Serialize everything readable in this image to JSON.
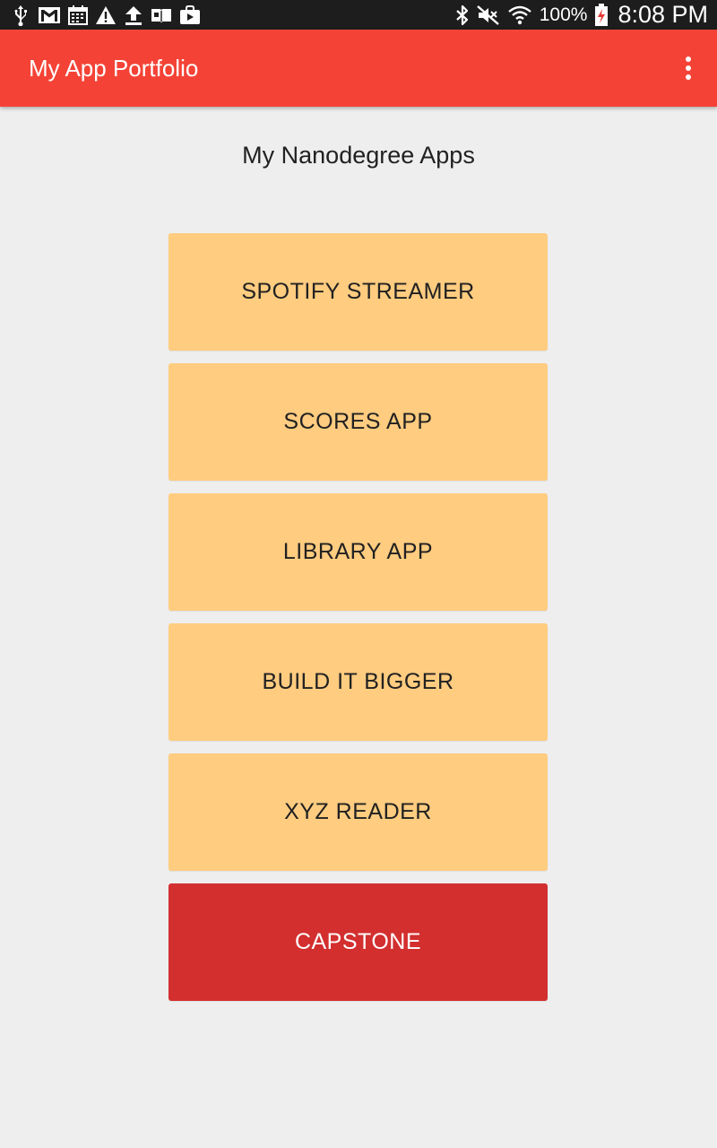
{
  "status_bar": {
    "battery": "100%",
    "time": "8:08 PM",
    "left_icons": [
      "usb-icon",
      "gmail-icon",
      "calendar-icon",
      "warning-icon",
      "upload-icon",
      "book-icon",
      "shopping-bag-icon"
    ],
    "right_icons": [
      "bluetooth-icon",
      "mute-icon",
      "wifi-icon",
      "battery-charging-icon"
    ]
  },
  "app_bar": {
    "title": "My App Portfolio",
    "menu_icon": "overflow-menu-icon",
    "color": "#f44336"
  },
  "main": {
    "heading": "My Nanodegree Apps",
    "buttons": [
      {
        "label": "SPOTIFY STREAMER",
        "color": "#ffcc80"
      },
      {
        "label": "SCORES APP",
        "color": "#ffcc80"
      },
      {
        "label": "LIBRARY APP",
        "color": "#ffcc80"
      },
      {
        "label": "BUILD IT BIGGER",
        "color": "#ffcc80"
      },
      {
        "label": "XYZ READER",
        "color": "#ffcc80"
      },
      {
        "label": "CAPSTONE",
        "color": "#d32f2f"
      }
    ]
  },
  "colors": {
    "background": "#eeeeee",
    "status_bar": "#1d1d1d",
    "accent": "#f44336",
    "button_default": "#ffcc80",
    "button_highlight": "#d32f2f"
  }
}
